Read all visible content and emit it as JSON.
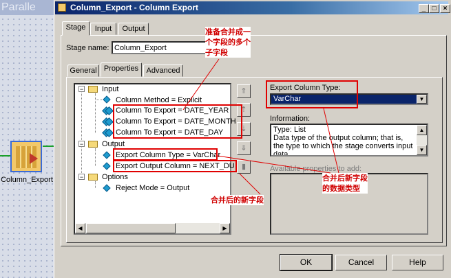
{
  "canvas": {
    "title": "Paralle",
    "stage_label": "Column_Export"
  },
  "window": {
    "title": "Column_Export - Column Export",
    "min": "_",
    "max": "□",
    "close": "×"
  },
  "tabs": [
    "Stage",
    "Input",
    "Output"
  ],
  "stage_name": {
    "label": "Stage name:",
    "value": "Column_Export"
  },
  "subtabs": [
    "General",
    "Properties",
    "Advanced"
  ],
  "tree": {
    "input": "Input",
    "column_method": "Column Method = Explicit",
    "cols": [
      "Column To Export = DATE_YEAR",
      "Column To Export = DATE_MONTH",
      "Column To Export = DATE_DAY"
    ],
    "output": "Output",
    "export_type": "Export Column Type = VarChar",
    "export_output": "Export Output Column = NEXT_DU",
    "options": "Options",
    "reject": "Reject Mode = Output"
  },
  "right": {
    "export_type_label": "Export Column Type:",
    "export_type_value": "VarChar",
    "info_label": "Information:",
    "info_text": "Type: List\nData type of the output column; that is, the type to which the stage converts input data.",
    "avail_label": "Available properties to add:"
  },
  "buttons": {
    "ok": "OK",
    "cancel": "Cancel",
    "help": "Help"
  },
  "annotations": {
    "fields": "准备合并成一\n个字段的多个\n子字段",
    "new_field": "合并后的新字段",
    "type": "合并后新字段\n的数据类型"
  },
  "colors": {
    "annotation": "#e00000",
    "titlebar": "#0a246a"
  }
}
